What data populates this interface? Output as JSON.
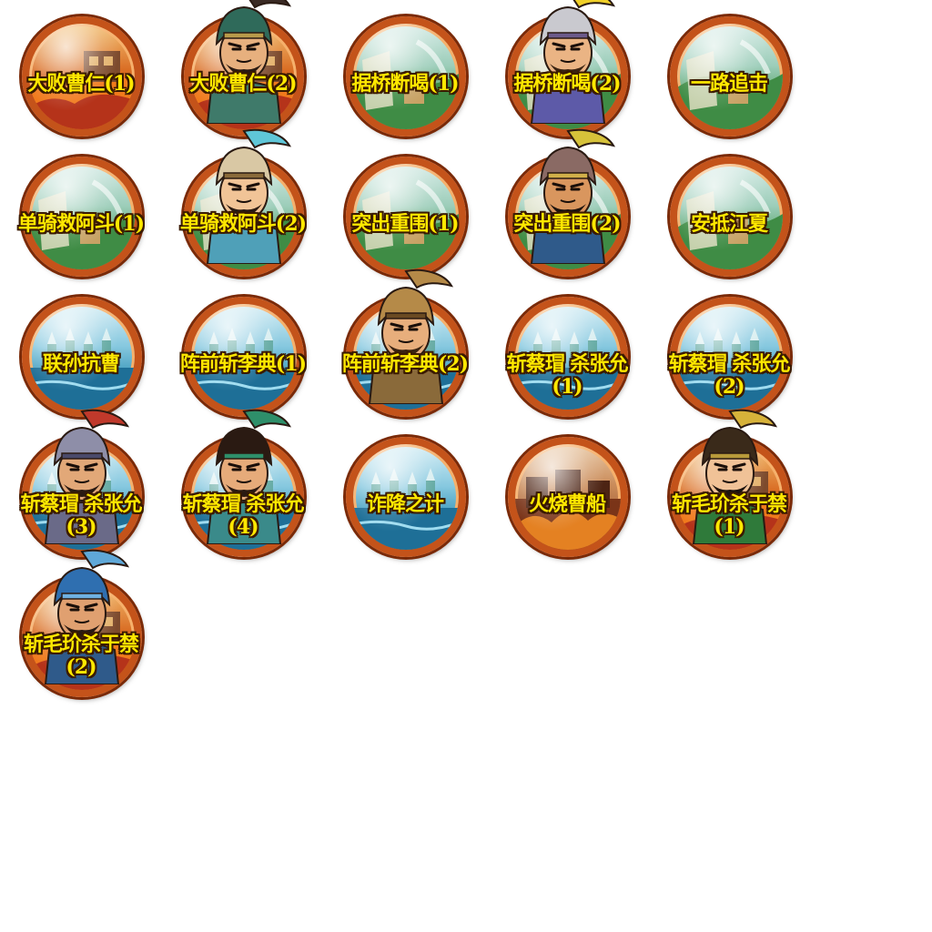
{
  "stages": [
    {
      "line1": "大败曹仁(1)",
      "line2": "",
      "scene": "fire",
      "hero": ""
    },
    {
      "line1": "大败曹仁(2)",
      "line2": "",
      "scene": "fire",
      "hero": "general-green-helmet"
    },
    {
      "line1": "据桥断喝(1)",
      "line2": "",
      "scene": "field",
      "hero": ""
    },
    {
      "line1": "据桥断喝(2)",
      "line2": "",
      "scene": "field",
      "hero": "general-gold-plume"
    },
    {
      "line1": "一路追击",
      "line2": "",
      "scene": "field",
      "hero": ""
    },
    {
      "line1": "单骑救阿斗(1)",
      "line2": "",
      "scene": "field",
      "hero": ""
    },
    {
      "line1": "单骑救阿斗(2)",
      "line2": "",
      "scene": "field",
      "hero": "general-blue-plume"
    },
    {
      "line1": "突出重围(1)",
      "line2": "",
      "scene": "field",
      "hero": ""
    },
    {
      "line1": "突出重围(2)",
      "line2": "",
      "scene": "field",
      "hero": "general-bearded-spear"
    },
    {
      "line1": "安抵江夏",
      "line2": "",
      "scene": "field",
      "hero": ""
    },
    {
      "line1": "联孙抗曹",
      "line2": "",
      "scene": "river",
      "hero": ""
    },
    {
      "line1": "阵前斩李典(1)",
      "line2": "",
      "scene": "river",
      "hero": ""
    },
    {
      "line1": "阵前斩李典(2)",
      "line2": "",
      "scene": "river",
      "hero": "general-bronze-helmet"
    },
    {
      "line1": "斩蔡瑁 杀张允",
      "line2": "(1)",
      "scene": "river",
      "hero": ""
    },
    {
      "line1": "斩蔡瑁 杀张允",
      "line2": "(2)",
      "scene": "river",
      "hero": ""
    },
    {
      "line1": "斩蔡瑁 杀张允",
      "line2": "(3)",
      "scene": "river",
      "hero": "general-grey-helmet"
    },
    {
      "line1": "斩蔡瑁 杀张允",
      "line2": "(4)",
      "scene": "river",
      "hero": "general-topknot"
    },
    {
      "line1": "诈降之计",
      "line2": "",
      "scene": "river",
      "hero": ""
    },
    {
      "line1": "火烧曹船",
      "line2": "",
      "scene": "city",
      "hero": ""
    },
    {
      "line1": "斩毛玠杀于禁",
      "line2": "(1)",
      "scene": "fire",
      "hero": "strategist-green-robe"
    },
    {
      "line1": "斩毛玠杀于禁",
      "line2": "(2)",
      "scene": "fire",
      "hero": "general-blue-scarf"
    }
  ],
  "colors": {
    "label_text": "#ffe800",
    "label_outline": "#3a1a00",
    "frame_ring": "#c4531a"
  }
}
